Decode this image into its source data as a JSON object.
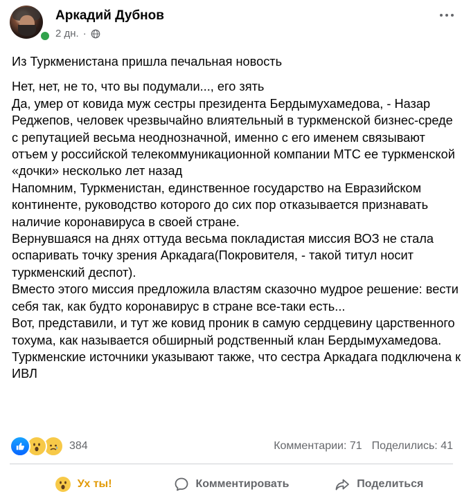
{
  "post": {
    "author": "Аркадий Дубнов",
    "time": "2 дн.",
    "separator": "·",
    "audience_icon": "globe-icon",
    "more_icon": "more-options-icon",
    "paragraphs": [
      "Из Туркменистана пришла печальная новость",
      "Нет, нет, не то, что вы подумали..., его зять",
      "Да, умер от ковида муж сестры президента Бердымухамедова, - Назар Реджепов, человек чрезвычайно влиятельный в туркменской бизнес-среде с репутацией весьма неоднозначной, именно с его именем связывают отъем у российской телекоммуникационной компании МТС ее туркменской «дочки» несколько лет назад",
      "Напомним, Туркменистан, единственное государство на Евразийском континенте, руководство которого до сих пор отказывается признавать наличие коронавируса в своей стране.",
      "Вернувшаяся на днях оттуда весьма покладистая миссия ВОЗ не стала оспаривать точку зрения Аркадага(Покровителя, - такой титул носит туркменский деспот).",
      "Вместо этого миссия предложила властям сказочно мудрое решение: вести себя так, как будто коронавирус в стране все-таки есть...",
      "Вот, представили, и тут же ковид проник в самую сердцевину царственного тохума, как называется обширный родственный клан Бердымухамедова.",
      "Туркменские источники указывают также, что сестра Аркадага подключена к ИВЛ"
    ]
  },
  "stats": {
    "reaction_icons": [
      "like-icon",
      "wow-icon",
      "sad-icon"
    ],
    "reaction_count": "384",
    "comments": "Комментарии: 71",
    "shares": "Поделились: 41"
  },
  "actions": {
    "react_label": "Ух ты!",
    "comment_label": "Комментировать",
    "share_label": "Поделиться"
  },
  "colors": {
    "accent_active": "#e29a07",
    "like_blue": "#0866ff",
    "online_green": "#31a24c",
    "muted_text": "#65676b"
  }
}
